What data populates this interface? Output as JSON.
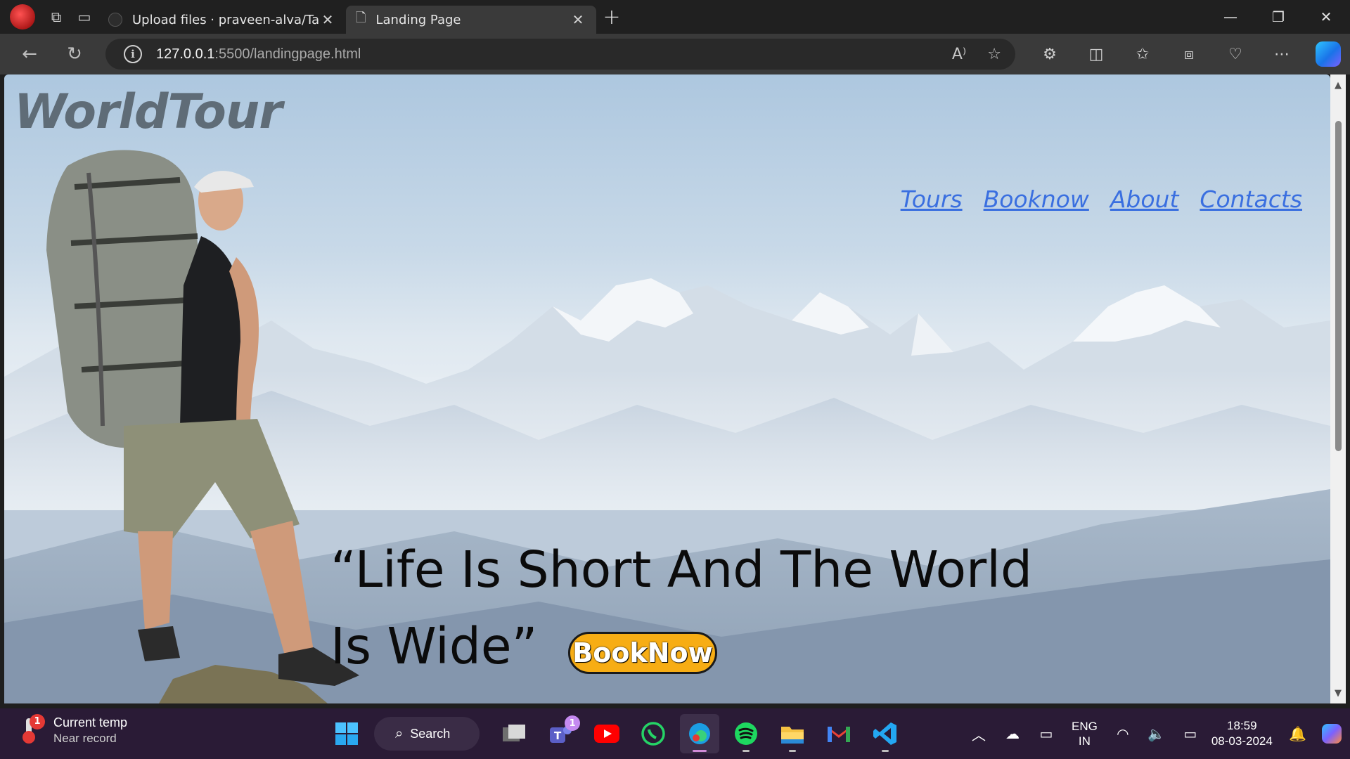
{
  "browser": {
    "tabs": [
      {
        "label": "Upload files · praveen-alva/Task-"
      },
      {
        "label": "Landing Page"
      }
    ],
    "address": {
      "host": "127.0.0.1",
      "rest": ":5500/landingpage.html"
    }
  },
  "page": {
    "logo": "WorldTour",
    "nav": [
      {
        "label": "Tours"
      },
      {
        "label": "Booknow"
      },
      {
        "label": "About"
      },
      {
        "label": "Contacts"
      }
    ],
    "quote_line1": "“Life Is Short And The World",
    "quote_line2": "Is Wide”",
    "cta": "BookNow"
  },
  "taskbar": {
    "weather": {
      "title": "Current temp",
      "subtitle": "Near record",
      "badge": "1"
    },
    "search_label": "Search",
    "teams_badge": "1",
    "language": {
      "line1": "ENG",
      "line2": "IN"
    },
    "clock": {
      "time": "18:59",
      "date": "08-03-2024"
    }
  },
  "colors": {
    "nav_link": "#3a6fe0",
    "cta_background": "#f7ad14",
    "logo_text": "#5f6c77",
    "taskbar": "#2a1b36"
  }
}
